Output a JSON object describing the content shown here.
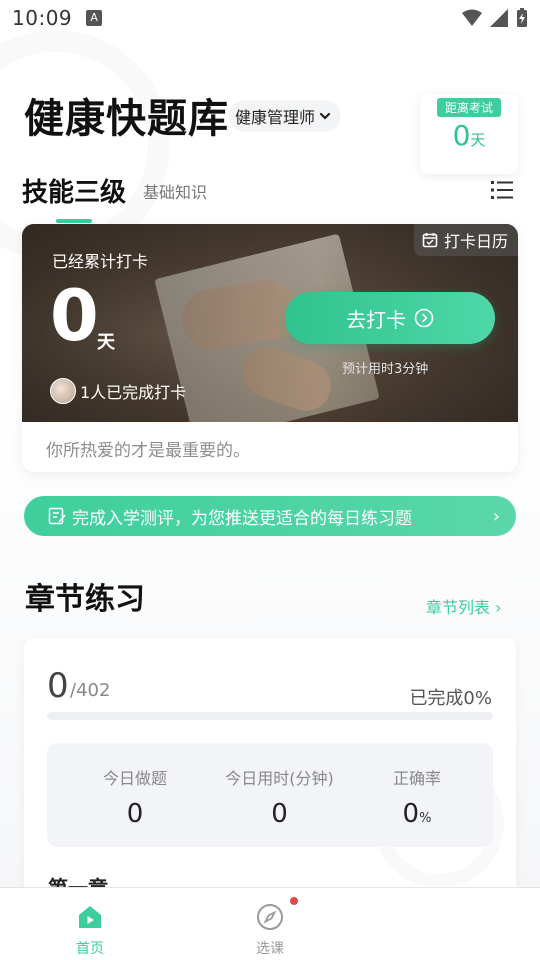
{
  "status_bar": {
    "time": "10:09",
    "a_badge": "A"
  },
  "header": {
    "app_title": "健康快题库",
    "profession": "健康管理师",
    "exam_countdown": {
      "label": "距离考试",
      "value": "0",
      "unit": "天"
    }
  },
  "level_tabs": [
    {
      "label": "技能三级",
      "active": true
    },
    {
      "label": "基础知识",
      "active": false
    }
  ],
  "checkin": {
    "calendar_label": "打卡日历",
    "accumulated_label": "已经累计打卡",
    "days": "0",
    "days_unit": "天",
    "completed_text": "1人已完成打卡",
    "go_button": "去打卡",
    "estimated_time": "预计用时3分钟",
    "quote": "你所热爱的才是最重要的。"
  },
  "assessment_banner": {
    "text": "完成入学测评，为您推送更适合的每日练习题"
  },
  "chapter_practice": {
    "title": "章节练习",
    "list_link": "章节列表",
    "done": "0",
    "total": "/402",
    "completed_pct": "已完成0%",
    "progress": 0,
    "stats": [
      {
        "label": "今日做题",
        "value": "0",
        "unit": ""
      },
      {
        "label": "今日用时(分钟)",
        "value": "0",
        "unit": ""
      },
      {
        "label": "正确率",
        "value": "0",
        "unit": "%"
      }
    ],
    "first_chapter": "第一章"
  },
  "bottom_nav": [
    {
      "label": "首页",
      "active": true
    },
    {
      "label": "选课",
      "active": false,
      "badge": true
    }
  ],
  "colors": {
    "accent": "#3ccf9c",
    "badge_red": "#e0494a"
  }
}
